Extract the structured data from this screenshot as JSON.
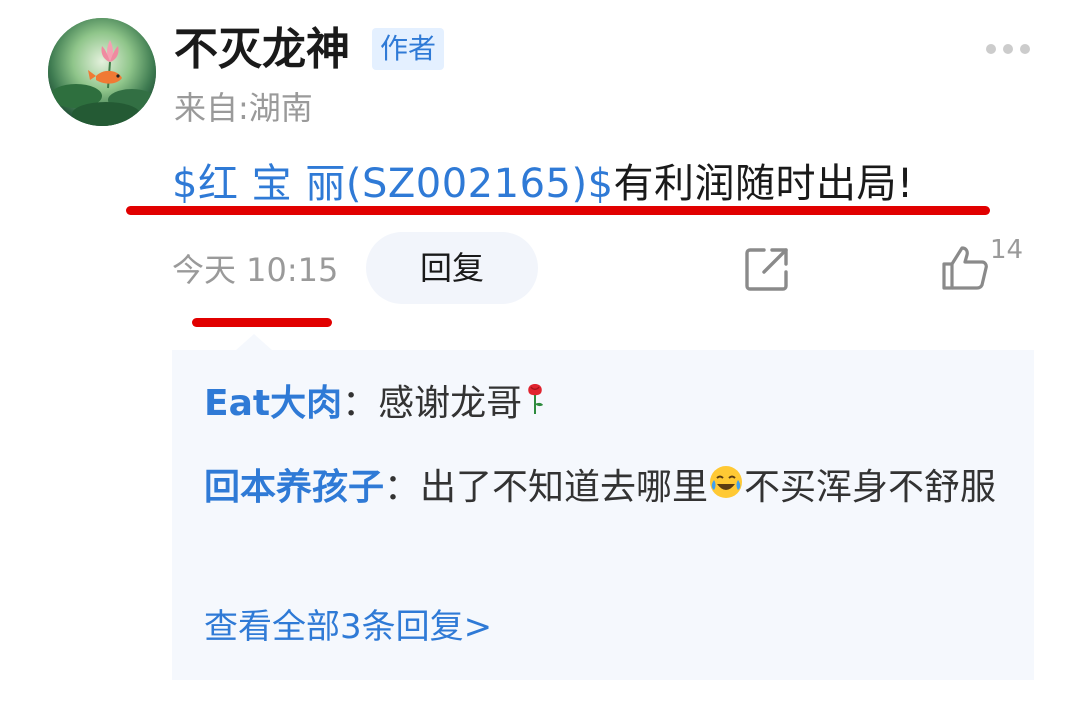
{
  "post": {
    "author": "不灭龙神",
    "author_badge": "作者",
    "location": "来自:湖南",
    "content_link": "$红 宝 丽(SZ002165)$",
    "content_text": "有利润随时出局!",
    "time": "今天 10:15",
    "reply_label": "回复",
    "like_count": "14",
    "icons": {
      "more": "more-dots-icon",
      "share": "share-icon",
      "like": "thumbs-up-icon"
    }
  },
  "replies": [
    {
      "user": "Eat大肉",
      "separator": "：",
      "text_before": "感谢龙哥",
      "emoji": "rose-emoji",
      "text_after": ""
    },
    {
      "user": "回本养孩子",
      "separator": "：",
      "text_before": "出了不知道去哪里",
      "emoji": "crying-laughing-emoji",
      "text_after": "不买浑身不舒服"
    }
  ],
  "view_all": "查看全部3条回复>",
  "colors": {
    "accent_blue": "#2f7ad6",
    "highlight_red": "#e10000",
    "muted_gray": "#9a9a9a",
    "reply_bg": "#f5f8fd"
  }
}
